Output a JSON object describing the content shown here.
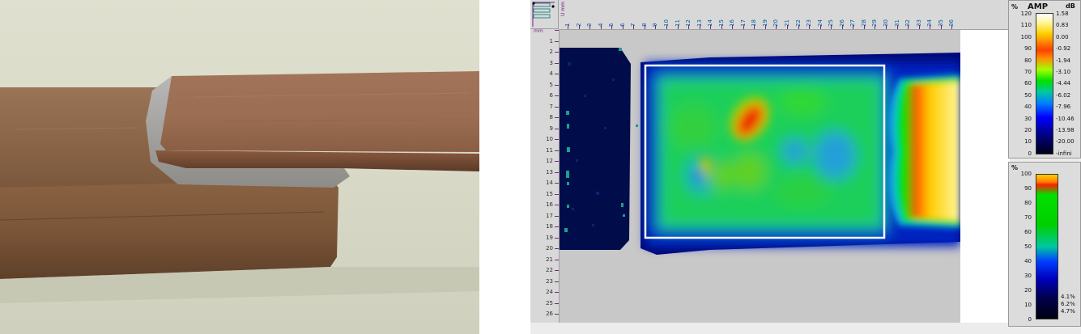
{
  "photo": {
    "subject": "",
    "alt": ""
  },
  "scan_view": {
    "x_axis": {
      "unit_label": "U mm",
      "ticks": [
        "1",
        "2",
        "3",
        "4",
        "5",
        "6",
        "7",
        "8",
        "9",
        "10",
        "11",
        "12",
        "13",
        "14",
        "15",
        "16",
        "17",
        "18",
        "19",
        "20",
        "21",
        "22",
        "23",
        "24",
        "25",
        "26",
        "27",
        "28",
        "29",
        "30",
        "31",
        "32",
        "33",
        "34",
        "35",
        "36"
      ]
    },
    "y_axis": {
      "unit_label": "mm",
      "ticks": [
        "0",
        "1",
        "2",
        "3",
        "4",
        "5",
        "6",
        "7",
        "8",
        "9",
        "10",
        "11",
        "12",
        "13",
        "14",
        "15",
        "16",
        "17",
        "18",
        "19",
        "20",
        "21",
        "22",
        "23",
        "24",
        "25",
        "26"
      ]
    },
    "colors": {
      "background": "#c8c8c8",
      "selection_box": "#ffffff",
      "ruler_text": "#0060a0",
      "ruler_marks": "#7a2080"
    }
  },
  "amplitude_scale": {
    "title": "AMP",
    "left_unit": "%",
    "right_unit": "dB",
    "percent_ticks": [
      "120",
      "110",
      "100",
      "90",
      "80",
      "70",
      "60",
      "50",
      "40",
      "30",
      "20",
      "10",
      "0"
    ],
    "db_ticks": [
      "1.58",
      "0.83",
      "0.00",
      "-0.92",
      "-1.94",
      "-3.10",
      "-4.44",
      "-6.02",
      "-7.96",
      "-10.46",
      "-13.98",
      "-20.00",
      "-infini"
    ]
  },
  "distribution_scale": {
    "unit": "%",
    "percent_ticks": [
      "100",
      "90",
      "80",
      "70",
      "60",
      "50",
      "40",
      "30",
      "20",
      "10",
      "0"
    ],
    "annotations": [
      "4.1%",
      "6.2%",
      "4.7%"
    ]
  }
}
